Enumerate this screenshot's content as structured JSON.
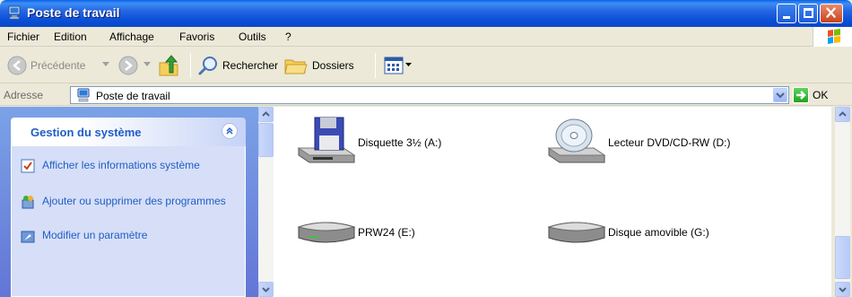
{
  "window": {
    "title": "Poste de travail",
    "title_icon": "my-computer-icon"
  },
  "menu": {
    "items": [
      "Fichier",
      "Edition",
      "Affichage",
      "Favoris",
      "Outils",
      "?"
    ]
  },
  "toolbar": {
    "back_label": "Précédente",
    "search_label": "Rechercher",
    "folders_label": "Dossiers"
  },
  "address": {
    "label": "Adresse",
    "value": "Poste de travail",
    "go_label": "OK"
  },
  "task_pane": {
    "title": "Gestion du système",
    "tasks": [
      {
        "label": "Afficher les informations système",
        "icon": "system-info-icon"
      },
      {
        "label": "Ajouter ou supprimer des programmes",
        "icon": "add-remove-programs-icon"
      },
      {
        "label": "Modifier un paramètre",
        "icon": "control-panel-icon"
      }
    ]
  },
  "drives": [
    {
      "label": "Disquette 3½ (A:)",
      "icon": "floppy-drive-icon"
    },
    {
      "label": "Lecteur DVD/CD-RW (D:)",
      "icon": "dvd-drive-icon"
    },
    {
      "label": "PRW24 (E:)",
      "icon": "hard-drive-icon"
    },
    {
      "label": "Disque amovible (G:)",
      "icon": "removable-drive-icon"
    }
  ],
  "colors": {
    "titlebar": "#0A4FD6",
    "taskpane": "#6375D6",
    "task_link": "#215DC6"
  }
}
